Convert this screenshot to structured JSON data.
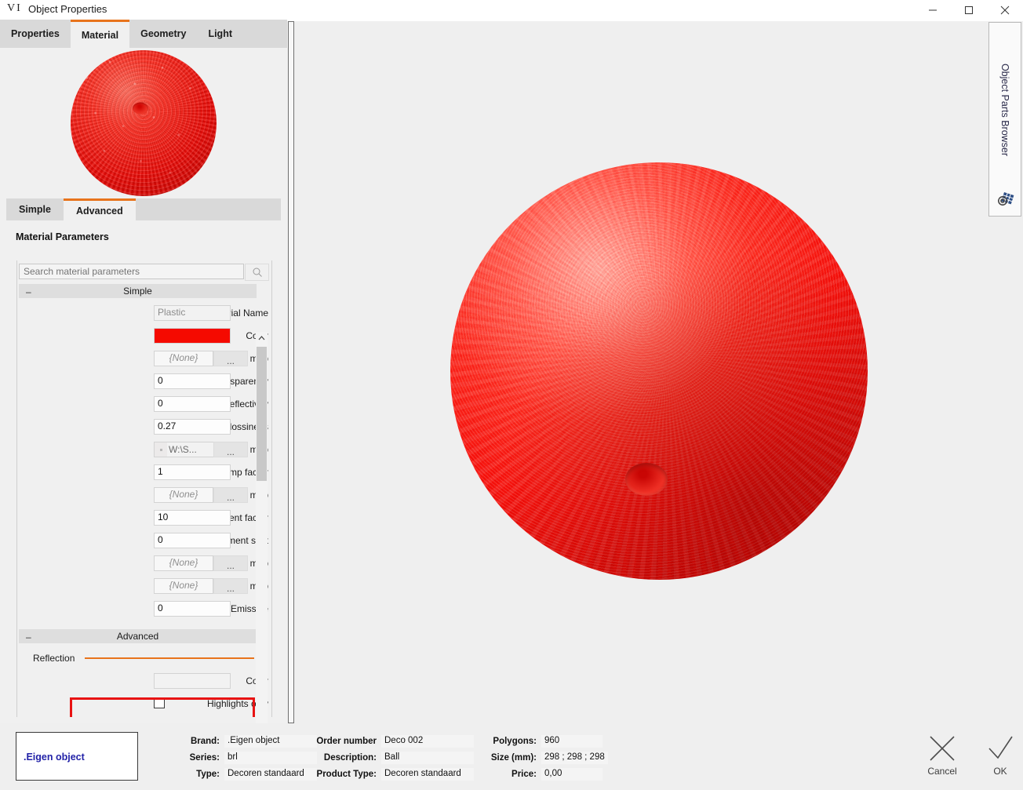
{
  "window": {
    "logo": "VI",
    "title": "Object Properties",
    "minimize_icon": "minimize-icon",
    "maximize_icon": "maximize-icon",
    "close_icon": "close-icon"
  },
  "tabs": [
    {
      "label": "Properties",
      "active": false
    },
    {
      "label": "Material",
      "active": true
    },
    {
      "label": "Geometry",
      "active": false
    },
    {
      "label": "Light",
      "active": false
    }
  ],
  "subtabs": [
    {
      "label": "Simple",
      "active": false
    },
    {
      "label": "Advanced",
      "active": true
    }
  ],
  "panel": {
    "section_title": "Material Parameters",
    "search": {
      "value": "",
      "placeholder": "Search material parameters",
      "icon": "search-icon"
    },
    "groups": [
      {
        "name": "Simple",
        "collapse_glyph": "–"
      },
      {
        "name": "Advanced",
        "collapse_glyph": "–"
      }
    ],
    "simple_rows": [
      {
        "label": "Material Name",
        "value": "Plastic",
        "kind": "text-gray"
      },
      {
        "label": "Color",
        "value": "",
        "kind": "color",
        "color": "#f50a00"
      },
      {
        "label": "Diffuse map",
        "value": "{None}",
        "kind": "map",
        "browse": "..."
      },
      {
        "label": "Transparency",
        "value": "0",
        "kind": "text"
      },
      {
        "label": "Reflectivity",
        "value": "0",
        "kind": "text"
      },
      {
        "label": "Glossiness",
        "value": "0.27",
        "kind": "text"
      },
      {
        "label": "Bump map",
        "value": "W:\\S...",
        "kind": "map-file",
        "browse": "..."
      },
      {
        "label": "Bump factor",
        "value": "1",
        "kind": "text"
      },
      {
        "label": "Displacement map",
        "value": "{None}",
        "kind": "map",
        "browse": "..."
      },
      {
        "label": "Displacement factor",
        "value": "10",
        "kind": "text"
      },
      {
        "label": "Displacement shift",
        "value": "0",
        "kind": "text"
      },
      {
        "label": "Reflection map",
        "value": "{None}",
        "kind": "map",
        "browse": "..."
      },
      {
        "label": "Glossiness map",
        "value": "{None}",
        "kind": "map",
        "browse": "..."
      },
      {
        "label": "Emissive",
        "value": "0",
        "kind": "text"
      }
    ],
    "advanced_rows": [
      {
        "label": "Reflection",
        "kind": "subheader"
      },
      {
        "label": "Color",
        "value": "",
        "kind": "color-empty"
      },
      {
        "label": "Highlights only",
        "value": "",
        "kind": "checkbox",
        "checked": false
      }
    ],
    "highlight_color": "#e81313",
    "accent_color": "#e8741c"
  },
  "right_sidebar": {
    "label": "Object Parts Browser",
    "icon": "parts-browser-icon"
  },
  "footer": {
    "thumbnail_label": ".Eigen object",
    "columns": [
      {
        "rows": [
          {
            "label": "Brand:",
            "value": ".Eigen object"
          },
          {
            "label": "Series:",
            "value": "brl"
          },
          {
            "label": "Type:",
            "value": "Decoren standaard"
          }
        ]
      },
      {
        "rows": [
          {
            "label": "Order number",
            "value": "Deco 002"
          },
          {
            "label": "Description:",
            "value": "Ball"
          },
          {
            "label": "Product Type:",
            "value": "Decoren standaard"
          }
        ]
      },
      {
        "rows": [
          {
            "label": "Polygons:",
            "value": "960"
          },
          {
            "label": "Size (mm):",
            "value": "298 ; 298 ; 298"
          },
          {
            "label": "Price:",
            "value": "0,00"
          }
        ]
      }
    ],
    "cancel": {
      "label": "Cancel",
      "icon": "x-icon"
    },
    "ok": {
      "label": "OK",
      "icon": "check-icon"
    }
  }
}
